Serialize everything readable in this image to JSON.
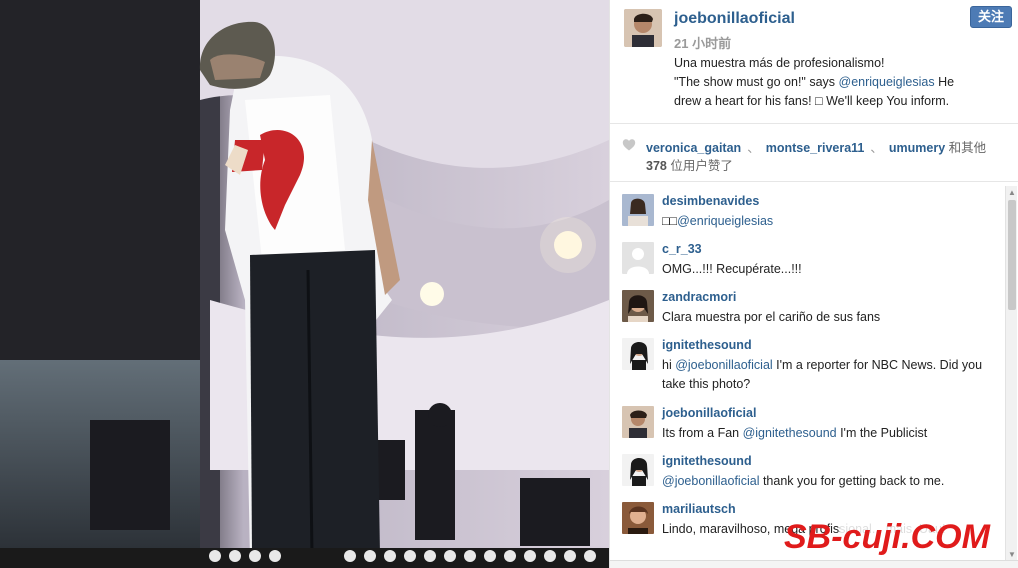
{
  "post": {
    "username": "joebonillaoficial",
    "time": "21 小时前",
    "follow_label": "关注",
    "caption": {
      "line1": "Una muestra más de profesionalismo!",
      "line2_pre": "\"The show must go on!\" says ",
      "line2_mention": "@enriqueiglesias",
      "line2_post": " He",
      "line3": "drew a heart for his fans! □    We'll keep You inform."
    }
  },
  "likes": {
    "likers": [
      "veronica_gaitan",
      "montse_rivera11",
      "umumery"
    ],
    "separator": "、",
    "others_label": "和其他",
    "count": "378",
    "count_suffix": " 位用户赞了"
  },
  "comments": [
    {
      "user": "desimbenavides",
      "text_pre": "□□",
      "mention": "@enriqueiglesias",
      "text_post": ""
    },
    {
      "user": "c_r_33",
      "text_pre": "OMG...!!! Recupérate...!!!",
      "mention": "",
      "text_post": ""
    },
    {
      "user": "zandracmori",
      "text_pre": "Clara muestra por el cariño de sus fans",
      "mention": "",
      "text_post": ""
    },
    {
      "user": "ignitethesound",
      "text_pre": "hi ",
      "mention": "@joebonillaoficial",
      "text_post": " I'm a reporter for NBC News. Did you take this photo?"
    },
    {
      "user": "joebonillaoficial",
      "text_pre": "Its from a Fan ",
      "mention": "@ignitethesound",
      "text_post": " I'm the Publicist"
    },
    {
      "user": "ignitethesound",
      "text_pre": "",
      "mention": "@joebonillaoficial",
      "text_post": " thank you for getting back to me."
    },
    {
      "user": "mariliautsch",
      "text_pre": "Lindo, maravilhoso, mega profissional... mais. Uau!",
      "mention": "",
      "text_post": ""
    }
  ],
  "watermark": "SB-cuji.COM",
  "colors": {
    "link": "#2d5f8e",
    "follow_button": "#4d7bb5"
  },
  "icons": {
    "heart": "heart-icon"
  }
}
